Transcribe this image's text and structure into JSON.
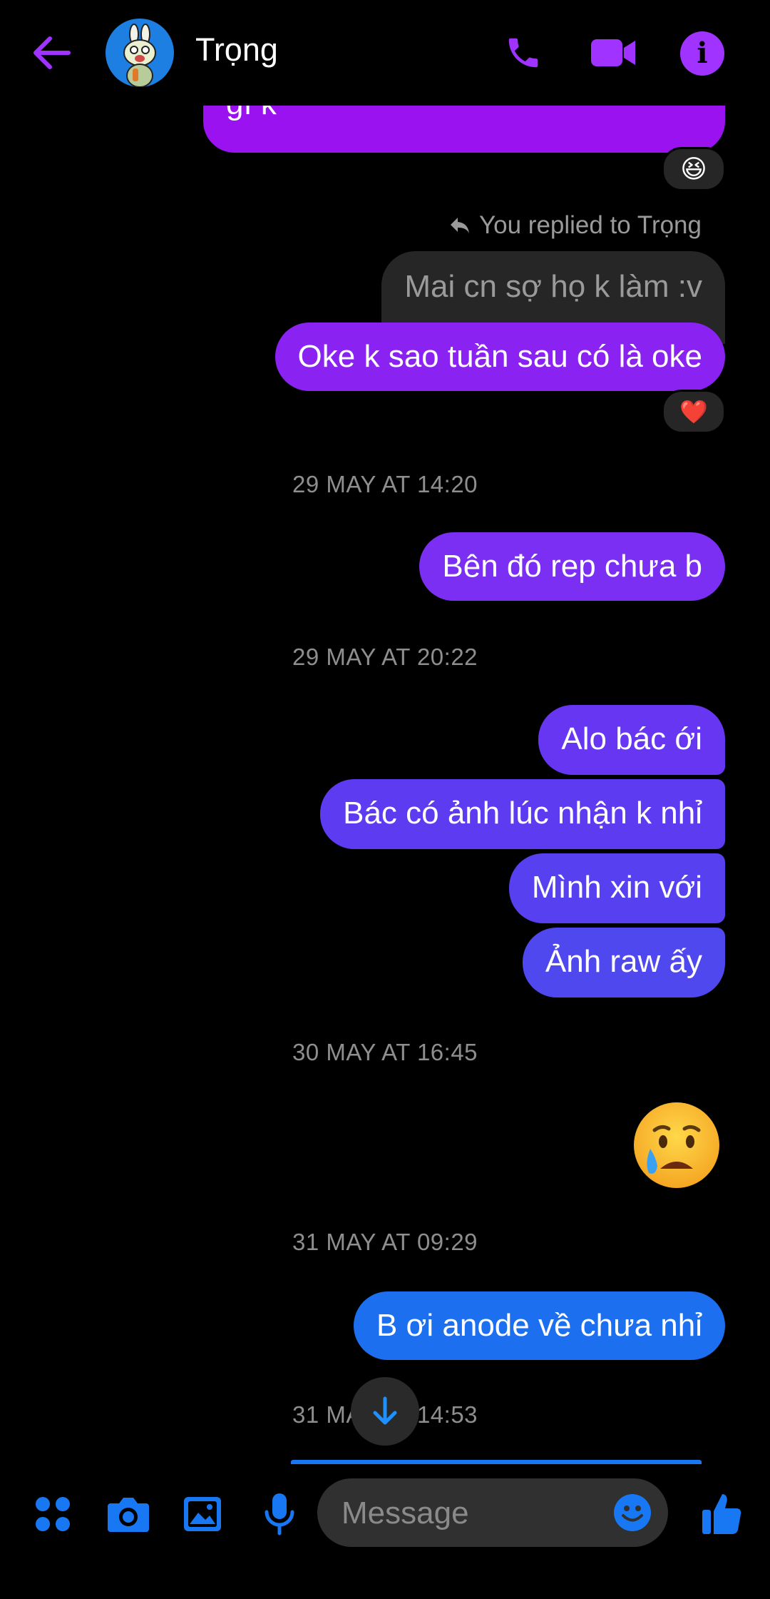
{
  "header": {
    "title": "Trọng",
    "back_icon": "back-arrow-icon",
    "call_icon": "phone-icon",
    "video_icon": "video-camera-icon",
    "info_icon": "info-icon",
    "accent": "#a033ff"
  },
  "messages": {
    "partial_message": "gì k",
    "partial_reaction": "😆",
    "reply_label": "You replied to Trọng",
    "quoted_text": "Mai cn sợ họ k làm :v",
    "reply_text": "Oke k sao tuần sau có là oke",
    "reply_reaction": "❤️",
    "stamp_1": "29 MAY AT 14:20",
    "msg_1": "Bên đó rep chưa b",
    "stamp_2": "29 MAY AT 20:22",
    "msg_2": "Alo bác ới",
    "msg_3": "Bác có ảnh lúc nhận k nhỉ",
    "msg_4": "Mình xin với",
    "msg_5": "Ảnh raw ấy",
    "stamp_3": "30 MAY AT 16:45",
    "emoji_msg": "😥",
    "stamp_4": "31 MAY AT 09:29",
    "msg_6": "B ơi anode về chưa nhỉ",
    "stamp_5": "31 MAY AT 14:53"
  },
  "composer": {
    "placeholder": "Message",
    "icons": [
      "menu-dots-icon",
      "camera-icon",
      "gallery-icon",
      "microphone-icon",
      "emoji-icon",
      "thumbs-up-icon"
    ]
  },
  "colors": {
    "purple_bubble": "#9b12f0",
    "violet_bubble": "#7b2ff2",
    "indigo_bubble": "#5a3ff0",
    "blue_bubble": "#1877f2",
    "received_bubble": "#262626",
    "blue_icon": "#1877f2"
  }
}
